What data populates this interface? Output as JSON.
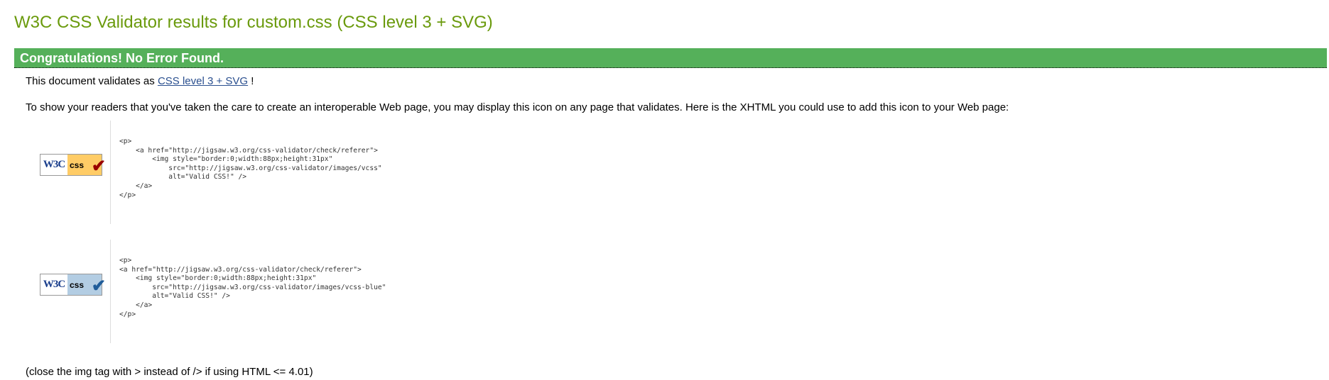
{
  "title": "W3C CSS Validator results for custom.css (CSS level 3 + SVG)",
  "banner": "Congratulations! No Error Found.",
  "validates": {
    "prefix": "This document validates as",
    "link": "CSS level 3 + SVG",
    "suffix": "!"
  },
  "intro": "To show your readers that you've taken the care to create an interoperable Web page, you may display this icon on any page that validates. Here is the XHTML you could use to add this icon to your Web page:",
  "badges": [
    {
      "w3c": "W3C",
      "css": "css",
      "color": "#ffcc66",
      "check_color": "#990000",
      "code": "<p>\n    <a href=\"http://jigsaw.w3.org/css-validator/check/referer\">\n        <img style=\"border:0;width:88px;height:31px\"\n            src=\"http://jigsaw.w3.org/css-validator/images/vcss\"\n            alt=\"Valid CSS!\" />\n    </a>\n</p>"
    },
    {
      "w3c": "W3C",
      "css": "css",
      "color": "#b3cde3",
      "check_color": "#1f5c99",
      "code": "<p>\n<a href=\"http://jigsaw.w3.org/css-validator/check/referer\">\n    <img style=\"border:0;width:88px;height:31px\"\n        src=\"http://jigsaw.w3.org/css-validator/images/vcss-blue\"\n        alt=\"Valid CSS!\" />\n    </a>\n</p>"
    }
  ],
  "footer": "(close the img tag with > instead of /> if using HTML <= 4.01)"
}
